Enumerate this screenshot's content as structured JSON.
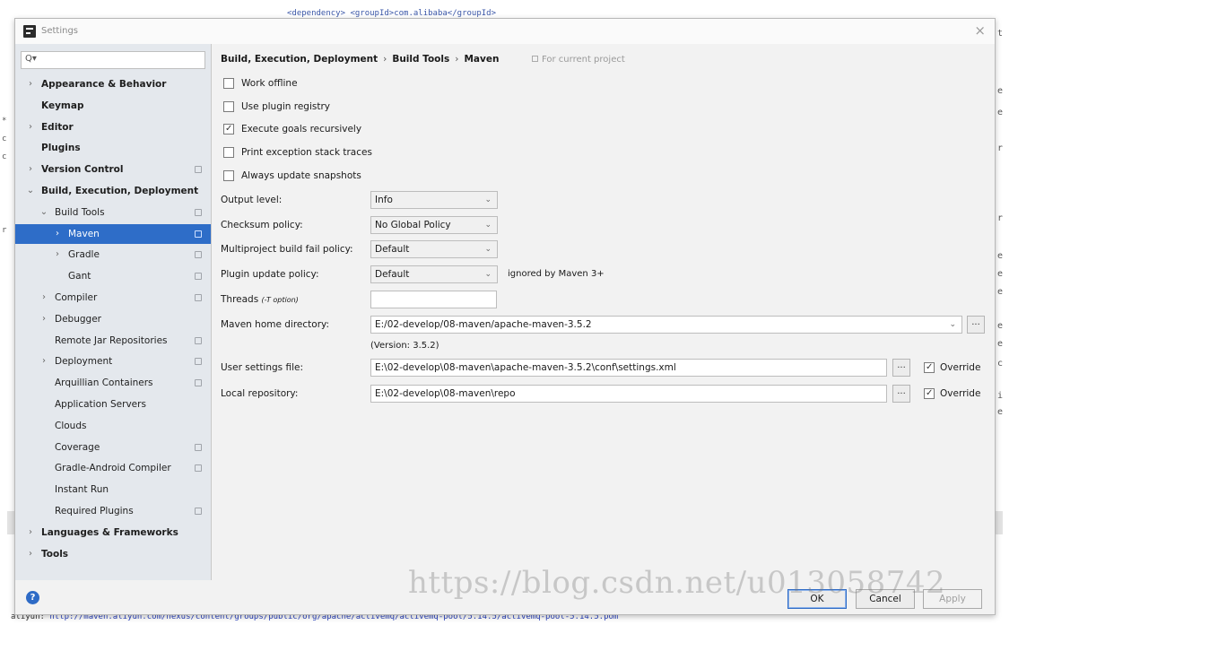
{
  "background": {
    "top_text": "<dependency> <groupId>com.alibaba</groupId>",
    "bottom_label": "aliyun: ",
    "bottom_link": "http://maven.aliyun.com/nexus/content/groups/public/org/apache/activemq/activemq-pool/5.14.5/activemq-pool-5.14.5.pom",
    "right_glyphs": [
      "t",
      "e",
      "e",
      "r",
      "r",
      "e",
      "e",
      "e",
      "e",
      "e",
      "c",
      "i",
      "e"
    ],
    "left_glyphs": [
      "*",
      "c",
      "c",
      "r"
    ]
  },
  "window": {
    "title": "Settings",
    "close_glyph": "×"
  },
  "sidebar": {
    "search_placeholder": "",
    "search_glyph": "Q▾",
    "items": [
      {
        "label": "Appearance & Behavior",
        "arrow": "›",
        "bold": true,
        "project": false
      },
      {
        "label": "Keymap",
        "arrow": "",
        "bold": true,
        "project": false
      },
      {
        "label": "Editor",
        "arrow": "›",
        "bold": true,
        "project": false
      },
      {
        "label": "Plugins",
        "arrow": "",
        "bold": true,
        "project": false
      },
      {
        "label": "Version Control",
        "arrow": "›",
        "bold": true,
        "project": true
      },
      {
        "label": "Build, Execution, Deployment",
        "arrow": "⌄",
        "bold": true,
        "project": false
      },
      {
        "label": "Build Tools",
        "arrow": "⌄",
        "bold": false,
        "project": true
      },
      {
        "label": "Maven",
        "arrow": "›",
        "bold": false,
        "project": true,
        "selected": true
      },
      {
        "label": "Gradle",
        "arrow": "›",
        "bold": false,
        "project": true
      },
      {
        "label": "Gant",
        "arrow": "",
        "bold": false,
        "project": true
      },
      {
        "label": "Compiler",
        "arrow": "›",
        "bold": false,
        "project": true
      },
      {
        "label": "Debugger",
        "arrow": "›",
        "bold": false,
        "project": false
      },
      {
        "label": "Remote Jar Repositories",
        "arrow": "",
        "bold": false,
        "project": true
      },
      {
        "label": "Deployment",
        "arrow": "›",
        "bold": false,
        "project": true
      },
      {
        "label": "Arquillian Containers",
        "arrow": "",
        "bold": false,
        "project": true
      },
      {
        "label": "Application Servers",
        "arrow": "",
        "bold": false,
        "project": false
      },
      {
        "label": "Clouds",
        "arrow": "",
        "bold": false,
        "project": false
      },
      {
        "label": "Coverage",
        "arrow": "",
        "bold": false,
        "project": true
      },
      {
        "label": "Gradle-Android Compiler",
        "arrow": "",
        "bold": false,
        "project": true
      },
      {
        "label": "Instant Run",
        "arrow": "",
        "bold": false,
        "project": false
      },
      {
        "label": "Required Plugins",
        "arrow": "",
        "bold": false,
        "project": true
      },
      {
        "label": "Languages & Frameworks",
        "arrow": "›",
        "bold": true,
        "project": false
      },
      {
        "label": "Tools",
        "arrow": "›",
        "bold": true,
        "project": false
      }
    ]
  },
  "breadcrumb": {
    "parts": [
      "Build, Execution, Deployment",
      "Build Tools",
      "Maven"
    ],
    "separator": "›",
    "for_project": "For current project"
  },
  "checkboxes": [
    {
      "label": "Work offline",
      "checked": false
    },
    {
      "label": "Use plugin registry",
      "checked": false
    },
    {
      "label": "Execute goals recursively",
      "checked": true
    },
    {
      "label": "Print exception stack traces",
      "checked": false
    },
    {
      "label": "Always update snapshots",
      "checked": false
    }
  ],
  "fields": {
    "output_level": {
      "label": "Output level:",
      "value": "Info"
    },
    "checksum_policy": {
      "label": "Checksum policy:",
      "value": "No Global Policy"
    },
    "multiproject_fail": {
      "label": "Multiproject build fail policy:",
      "value": "Default"
    },
    "plugin_update": {
      "label": "Plugin update policy:",
      "value": "Default",
      "note": "ignored by Maven 3+"
    },
    "threads": {
      "label": "Threads",
      "hint": "(-T option)",
      "value": ""
    },
    "maven_home": {
      "label": "Maven home directory:",
      "value": "E:/02-develop/08-maven/apache-maven-3.5.2",
      "version": "(Version: 3.5.2)"
    },
    "user_settings": {
      "label": "User settings file:",
      "value": "E:\\02-develop\\08-maven\\apache-maven-3.5.2\\conf\\settings.xml",
      "override_label": "Override",
      "override_checked": true
    },
    "local_repo": {
      "label": "Local repository:",
      "value": "E:\\02-develop\\08-maven\\repo",
      "override_label": "Override",
      "override_checked": true
    }
  },
  "icons": {
    "combo_chevron": "⌄",
    "browse": "...",
    "help": "?"
  },
  "buttons": {
    "ok": "OK",
    "cancel": "Cancel",
    "apply": "Apply"
  },
  "watermark": "https://blog.csdn.net/u013058742",
  "colors": {
    "selection": "#2e6dc8",
    "sidebar_bg": "#e4e8ed",
    "dialog_bg": "#f2f2f2"
  }
}
